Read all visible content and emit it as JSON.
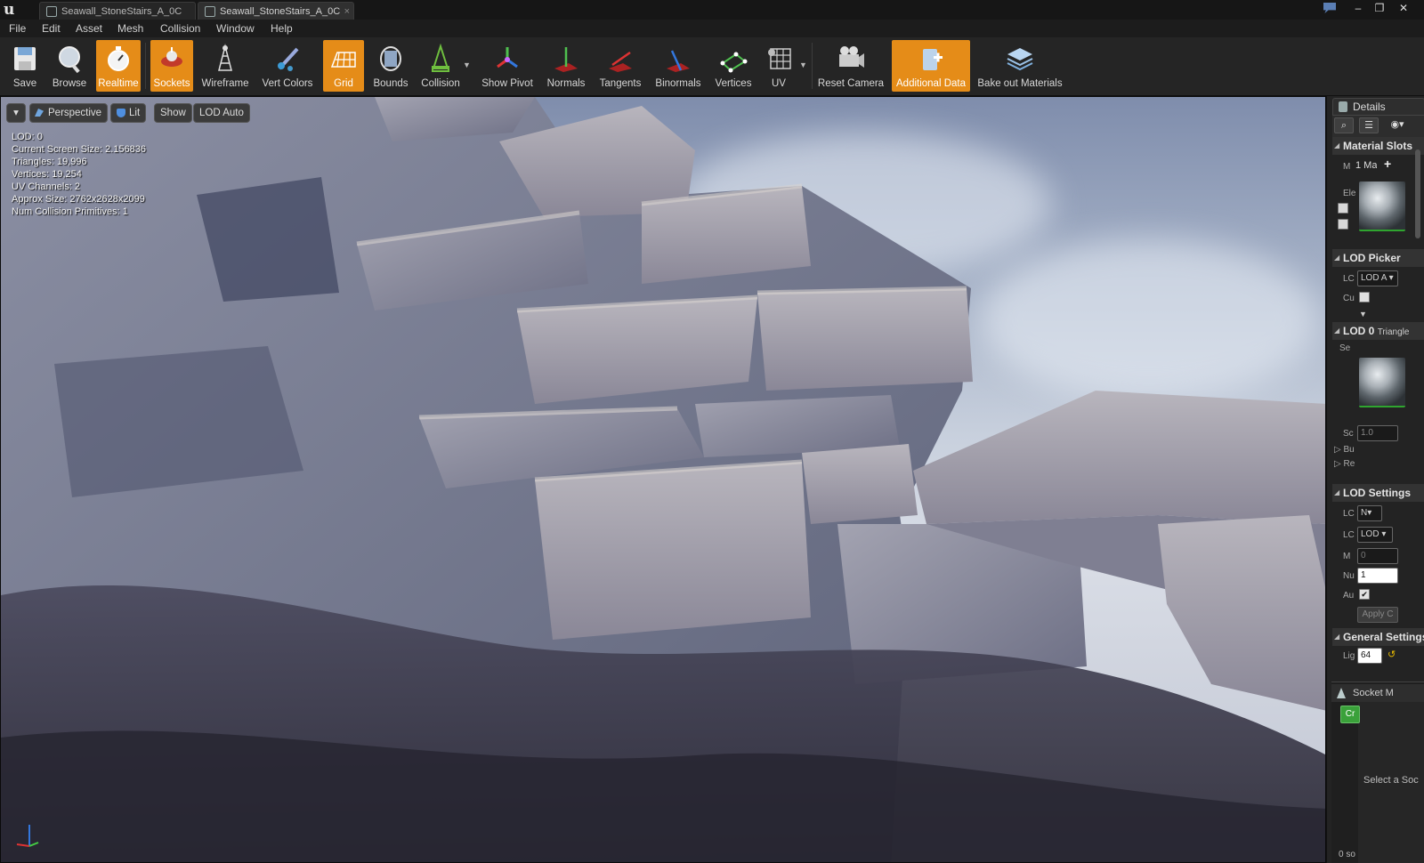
{
  "titlebar": {
    "logo": "u",
    "tabs": [
      {
        "label": "Seawall_StoneStairs_A_0C"
      },
      {
        "label": "Seawall_StoneStairs_A_0C"
      }
    ],
    "controls": {
      "minimize": "–",
      "maximize": "❐",
      "close": "✕"
    }
  },
  "menubar": {
    "items": [
      "File",
      "Edit",
      "Asset",
      "Mesh",
      "Collision",
      "Window",
      "Help"
    ]
  },
  "toolbar": {
    "buttons": [
      {
        "label": "Save",
        "icon": "save-icon",
        "active": false
      },
      {
        "label": "Browse",
        "icon": "browse-icon",
        "active": false
      },
      {
        "label": "Realtime",
        "icon": "realtime-icon",
        "active": true
      },
      {
        "label": "Sockets",
        "icon": "sockets-icon",
        "active": true
      },
      {
        "label": "Wireframe",
        "icon": "wireframe-icon",
        "active": false
      },
      {
        "label": "Vert Colors",
        "icon": "vert-colors-icon",
        "active": false
      },
      {
        "label": "Grid",
        "icon": "grid-icon",
        "active": true
      },
      {
        "label": "Bounds",
        "icon": "bounds-icon",
        "active": false
      },
      {
        "label": "Collision",
        "icon": "collision-icon",
        "active": false
      },
      {
        "label": "Show Pivot",
        "icon": "pivot-icon",
        "active": false
      },
      {
        "label": "Normals",
        "icon": "normals-icon",
        "active": false
      },
      {
        "label": "Tangents",
        "icon": "tangents-icon",
        "active": false
      },
      {
        "label": "Binormals",
        "icon": "binormals-icon",
        "active": false
      },
      {
        "label": "Vertices",
        "icon": "vertices-icon",
        "active": false
      },
      {
        "label": "UV",
        "icon": "uv-icon",
        "active": false
      },
      {
        "label": "Reset Camera",
        "icon": "camera-icon",
        "active": false
      },
      {
        "label": "Additional Data",
        "icon": "additional-data-icon",
        "active": true
      },
      {
        "label": "Bake out Materials",
        "icon": "bake-materials-icon",
        "active": false
      }
    ]
  },
  "viewport": {
    "buttons": {
      "options": "▾",
      "perspective": "Perspective",
      "lit": "Lit",
      "show": "Show",
      "lod": "LOD Auto"
    },
    "stats": [
      "LOD:  0",
      "Current Screen Size:  2.156836",
      "Triangles:  19,996",
      "Vertices:  19,254",
      "UV Channels:  2",
      "Approx Size: 2762x2628x2099",
      "Num Collision Primitives:  1"
    ]
  },
  "details": {
    "tab_label": "Details",
    "material_slots": {
      "header": "Material Slots",
      "row_label": "M",
      "count": "1 Ma",
      "elem_label": "Ele"
    },
    "lod_picker": {
      "header": "LOD Picker",
      "lod_label": "LC",
      "lod_value": "LOD A",
      "custom_label": "Cu"
    },
    "lod0": {
      "header": "LOD 0",
      "triangles": "Triangle",
      "section_label": "Se",
      "screen_size_label": "Sc",
      "screen_size_value": "1.0",
      "build_label": "Bu",
      "reduction_label": "Re"
    },
    "lod_settings": {
      "header": "LOD Settings",
      "group_label": "LC",
      "group_value": "N",
      "import_label": "LC",
      "import_value": "LOD",
      "min_label": "M",
      "min_value": "0",
      "num_label": "Nu",
      "num_value": "1",
      "auto_label": "Au",
      "apply_label": "Apply C"
    },
    "general_settings": {
      "header": "General Settings",
      "light_label": "Lig",
      "light_value": "64"
    }
  },
  "socket_manager": {
    "tab_label": "Socket M",
    "create_label": "Cr",
    "hint": "Select a Soc",
    "count": "0 so"
  }
}
